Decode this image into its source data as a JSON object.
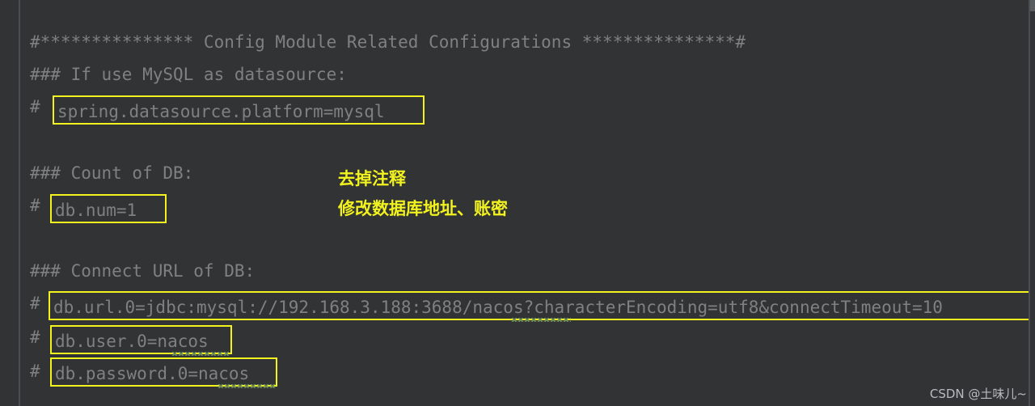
{
  "editor": {
    "background_color": "#313335",
    "gutter_color": "#313335",
    "divider_color": "#4b4e50",
    "comment_color": "#808080",
    "highlight_border_color": "#f2f21f",
    "annotation_color": "#f2f21f",
    "squiggle_color": "#6a8759",
    "font_size_px": 21,
    "line_height_px": 40
  },
  "lines": [
    {
      "id": "banner",
      "prefix": "",
      "text": "#*************** Config Module Related Configurations ***************#",
      "highlighted": false
    },
    {
      "id": "if-use-mysql",
      "prefix": "",
      "text": "### If use MySQL as datasource:",
      "highlighted": false
    },
    {
      "id": "spring-datasource-platform",
      "prefix": "#",
      "text": "spring.datasource.platform=mysql",
      "highlighted": true
    },
    {
      "id": "blank-1",
      "prefix": "",
      "text": "",
      "highlighted": false
    },
    {
      "id": "count-of-db",
      "prefix": "",
      "text": "### Count of DB:",
      "highlighted": false
    },
    {
      "id": "db-num",
      "prefix": "#",
      "text": "db.num=1",
      "highlighted": true
    },
    {
      "id": "blank-2",
      "prefix": "",
      "text": "",
      "highlighted": false
    },
    {
      "id": "connect-url-of-db",
      "prefix": "",
      "text": "### Connect URL of DB:",
      "highlighted": false
    },
    {
      "id": "db-url-0",
      "prefix": "#",
      "text": "db.url.0=jdbc:mysql://192.168.3.188:3688/nacos?characterEncoding=utf8&connectTimeout=10",
      "highlighted": true
    },
    {
      "id": "db-user-0",
      "prefix": "#",
      "text": "db.user.0=nacos",
      "highlighted": true
    },
    {
      "id": "db-password-0",
      "prefix": "#",
      "text": "db.password.0=nacos",
      "highlighted": true
    }
  ],
  "annotations": {
    "line1": "去掉注释",
    "line2": "修改数据库地址、账密"
  },
  "watermark": {
    "text": "CSDN @土味儿~"
  }
}
